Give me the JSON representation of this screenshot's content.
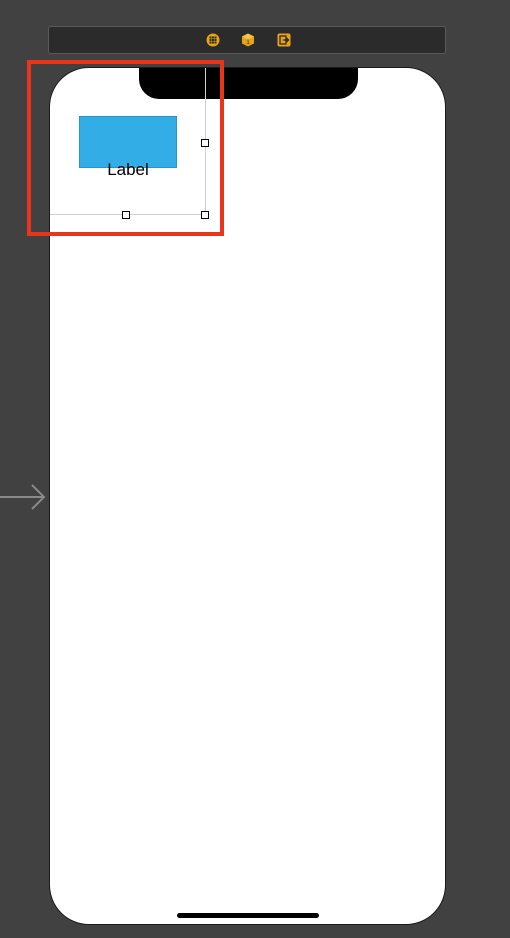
{
  "toolbar": {
    "icons": [
      "view-controller-icon",
      "first-responder-icon",
      "exit-icon"
    ],
    "icon_color": "#e8a317"
  },
  "device": {
    "label_view": {
      "text": "Label"
    },
    "blue_view_color": "#32ade6"
  },
  "highlight": {
    "color": "#e8361c"
  }
}
